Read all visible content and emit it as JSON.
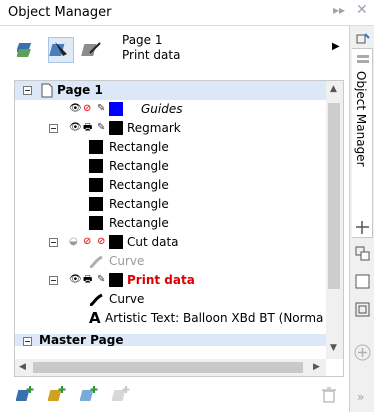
{
  "panel": {
    "title": "Object Manager"
  },
  "toolbar": {
    "page_name": "Page 1",
    "layer_name": "Print data"
  },
  "tree": {
    "rows": [
      {
        "label": "Page 1"
      },
      {
        "label": "Guides"
      },
      {
        "label": "Regmark"
      },
      {
        "label": "Rectangle"
      },
      {
        "label": "Rectangle"
      },
      {
        "label": "Rectangle"
      },
      {
        "label": "Rectangle"
      },
      {
        "label": "Rectangle"
      },
      {
        "label": "Cut data"
      },
      {
        "label": "Curve"
      },
      {
        "label": "Print data"
      },
      {
        "label": "Curve"
      },
      {
        "label": "Artistic Text: Balloon XBd BT (Norma"
      },
      {
        "label": "Master Page"
      }
    ]
  },
  "docker": {
    "tab_label": "Object Manager"
  },
  "colors": {
    "guides": "#0000ff",
    "active_layer": "#e00000",
    "selection": "#dce8f7",
    "accent": "#3b8fd9"
  }
}
